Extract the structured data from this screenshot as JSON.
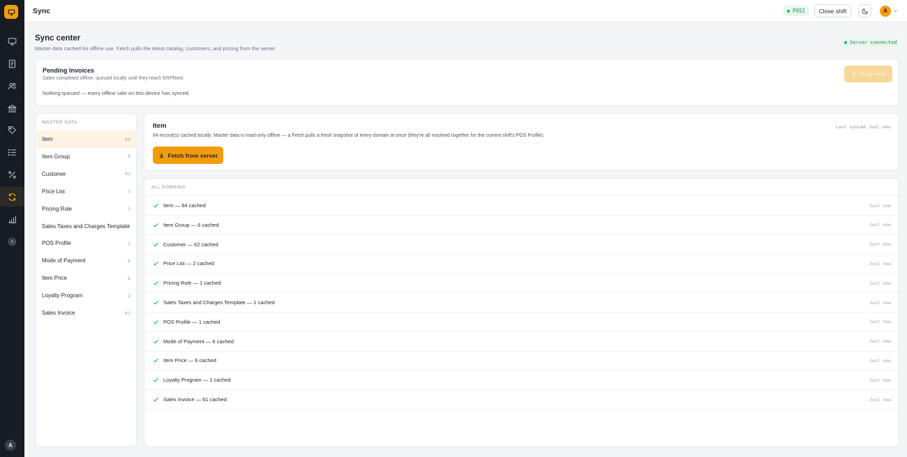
{
  "sidebar": {
    "logo_icon": "monitor-logo-icon",
    "nav": [
      {
        "icon": "monitor-icon",
        "active": false
      },
      {
        "icon": "receipt-icon",
        "active": false
      },
      {
        "icon": "users-icon",
        "active": false
      },
      {
        "icon": "bank-icon",
        "active": false
      },
      {
        "icon": "tag-icon",
        "active": false
      },
      {
        "icon": "list-icon",
        "active": false
      },
      {
        "icon": "percent-icon",
        "active": false
      },
      {
        "icon": "sync-icon",
        "active": true
      },
      {
        "icon": "bar-chart-icon",
        "active": false
      },
      {
        "icon": "settings-icon",
        "active": false
      }
    ],
    "user_initial": "A"
  },
  "topbar": {
    "title": "Sync",
    "pos_badge": "POS1",
    "close_shift": "Close shift",
    "theme_icon": "moon-icon",
    "user_initial": "A"
  },
  "header": {
    "title": "Sync center",
    "subtitle": "Master data cached for offline use. Fetch pulls the latest catalog, customers, and pricing from the server.",
    "server_status": "Server connected"
  },
  "pending": {
    "title": "Pending Invoices",
    "subtitle": "Sales completed offline, queued locally until they reach ERPNext.",
    "empty_text": "Nothing queued — every offline sale on this device has synced.",
    "push_label": "Push now"
  },
  "master": {
    "header": "MASTER DATA",
    "items": [
      {
        "label": "Item",
        "count": "64",
        "active": true
      },
      {
        "label": "Item Group",
        "count": "6"
      },
      {
        "label": "Customer",
        "count": "62"
      },
      {
        "label": "Price List",
        "count": "2"
      },
      {
        "label": "Pricing Rule",
        "count": "1"
      },
      {
        "label": "Sales Taxes and Charges Template",
        "count": "1"
      },
      {
        "label": "POS Profile",
        "count": "1"
      },
      {
        "label": "Mode of Payment",
        "count": "6"
      },
      {
        "label": "Item Price",
        "count": "6"
      },
      {
        "label": "Loyalty Program",
        "count": "1"
      },
      {
        "label": "Sales Invoice",
        "count": "61"
      }
    ]
  },
  "detail": {
    "title": "Item",
    "last_synced": "Last synced Just now",
    "description": "64 record(s) cached locally. Master data is read-only offline — a Fetch pulls a fresh snapshot of every domain at once (they're all resolved together for the current shift's POS Profile).",
    "fetch_label": "Fetch from server"
  },
  "domains": {
    "header": "ALL DOMAINS",
    "rows": [
      {
        "label": "Item — 64 cached",
        "time": "Just now"
      },
      {
        "label": "Item Group — 6 cached",
        "time": "Just now"
      },
      {
        "label": "Customer — 62 cached",
        "time": "Just now"
      },
      {
        "label": "Price List — 2 cached",
        "time": "Just now"
      },
      {
        "label": "Pricing Rule — 1 cached",
        "time": "Just now"
      },
      {
        "label": "Sales Taxes and Charges Template — 1 cached",
        "time": "Just now"
      },
      {
        "label": "POS Profile — 1 cached",
        "time": "Just now"
      },
      {
        "label": "Mode of Payment — 6 cached",
        "time": "Just now"
      },
      {
        "label": "Item Price — 6 cached",
        "time": "Just now"
      },
      {
        "label": "Loyalty Program — 1 cached",
        "time": "Just now"
      },
      {
        "label": "Sales Invoice — 61 cached",
        "time": "Just now"
      }
    ]
  },
  "colors": {
    "accent": "#f29d0c",
    "success": "#22b35f",
    "sidebar_bg": "#171b24"
  }
}
